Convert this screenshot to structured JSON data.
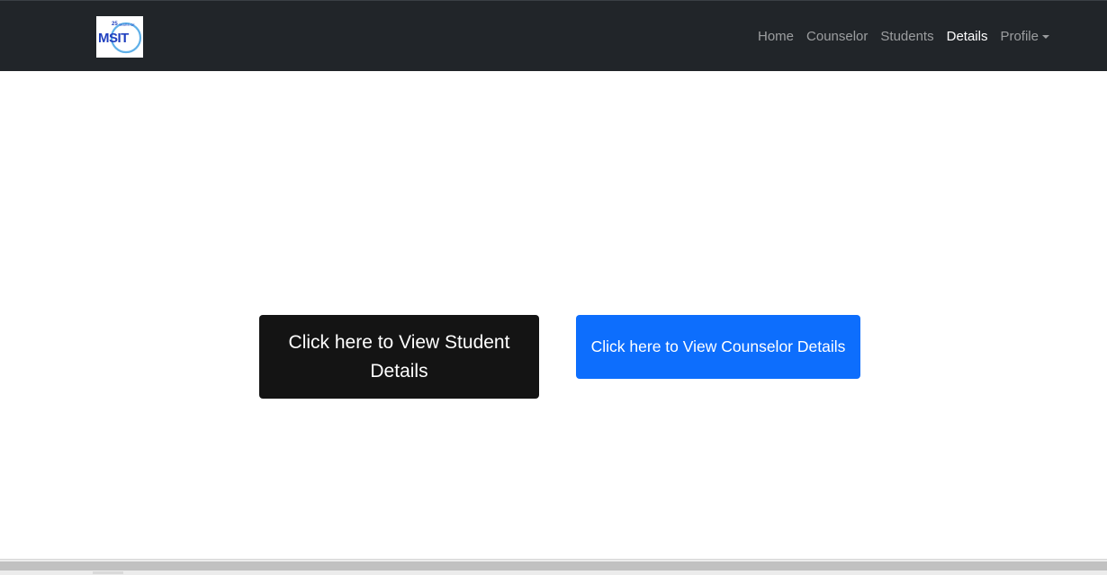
{
  "navbar": {
    "logo": {
      "text": "MSIT",
      "caption": "YEARS OF",
      "number": "25"
    },
    "links": [
      {
        "label": "Home",
        "active": false
      },
      {
        "label": "Counselor",
        "active": false
      },
      {
        "label": "Students",
        "active": false
      },
      {
        "label": "Details",
        "active": true
      },
      {
        "label": "Profile",
        "active": false,
        "dropdown": true
      }
    ]
  },
  "main": {
    "student_button": "Click here to View Student Details",
    "counselor_button": "Click here to View Counselor Details"
  },
  "colors": {
    "navbar_bg": "#212529",
    "student_button_bg": "#141414",
    "counselor_button_bg": "#0d6efd",
    "logo_blue": "#1f3fbf"
  }
}
